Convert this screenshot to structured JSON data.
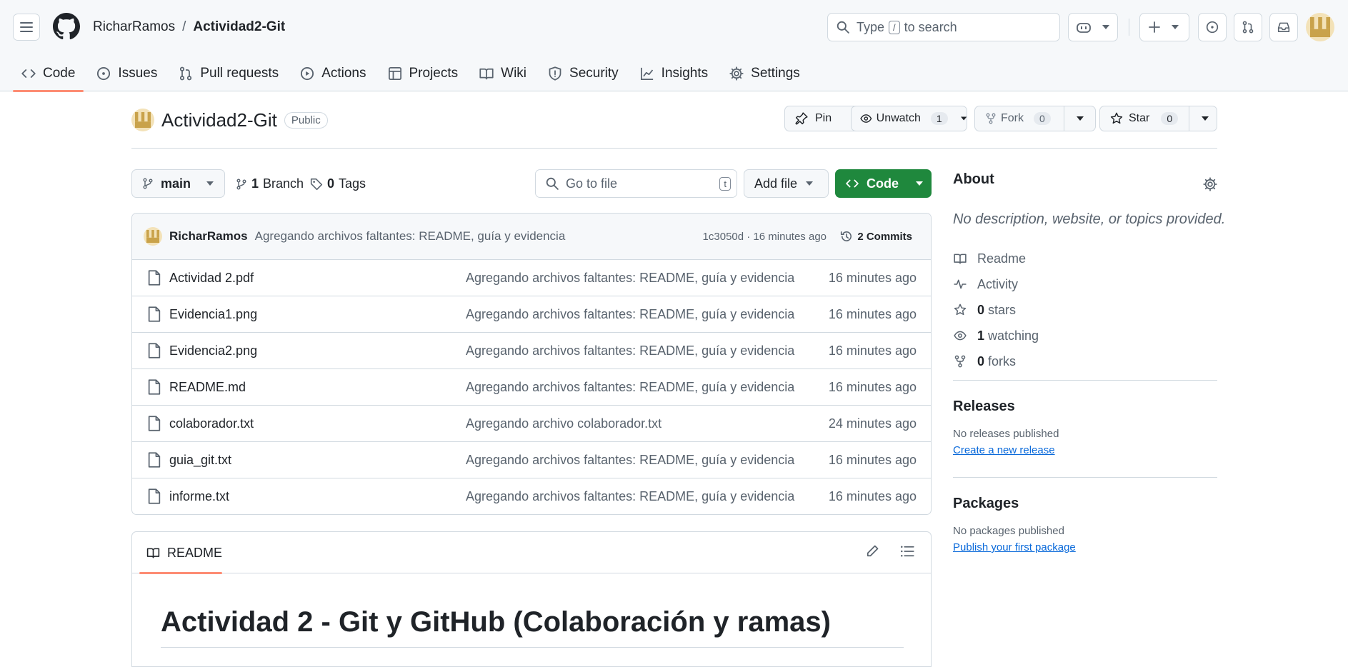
{
  "header": {
    "owner": "RicharRamos",
    "separator": "/",
    "repo": "Actividad2-Git",
    "search_prefix": "Type",
    "search_key": "/",
    "search_suffix": "to search"
  },
  "tabs": [
    {
      "label": "Code",
      "icon": "code-icon"
    },
    {
      "label": "Issues",
      "icon": "issue-icon"
    },
    {
      "label": "Pull requests",
      "icon": "pull-request-icon"
    },
    {
      "label": "Actions",
      "icon": "play-icon"
    },
    {
      "label": "Projects",
      "icon": "table-icon"
    },
    {
      "label": "Wiki",
      "icon": "book-icon"
    },
    {
      "label": "Security",
      "icon": "shield-icon"
    },
    {
      "label": "Insights",
      "icon": "graph-icon"
    },
    {
      "label": "Settings",
      "icon": "gear-icon"
    }
  ],
  "repo": {
    "name": "Actividad2-Git",
    "visibility": "Public",
    "pin_label": "Pin",
    "watch_label": "Unwatch",
    "watch_count": "1",
    "fork_label": "Fork",
    "fork_count": "0",
    "star_label": "Star",
    "star_count": "0"
  },
  "toolbar": {
    "branch": "main",
    "branches_count": "1",
    "branches_label": "Branch",
    "tags_count": "0",
    "tags_label": "Tags",
    "goto_placeholder": "Go to file",
    "goto_key": "t",
    "add_file_label": "Add file",
    "code_label": "Code"
  },
  "commit": {
    "author": "RicharRamos",
    "message": "Agregando archivos faltantes: README, guía y evidencia",
    "sha_time": "1c3050d · 16 minutes ago",
    "commits_label": "2 Commits"
  },
  "files": [
    {
      "name": "Actividad 2.pdf",
      "message": "Agregando archivos faltantes: README, guía y evidencia",
      "time": "16 minutes ago"
    },
    {
      "name": "Evidencia1.png",
      "message": "Agregando archivos faltantes: README, guía y evidencia",
      "time": "16 minutes ago"
    },
    {
      "name": "Evidencia2.png",
      "message": "Agregando archivos faltantes: README, guía y evidencia",
      "time": "16 minutes ago"
    },
    {
      "name": "README.md",
      "message": "Agregando archivos faltantes: README, guía y evidencia",
      "time": "16 minutes ago"
    },
    {
      "name": "colaborador.txt",
      "message": "Agregando archivo colaborador.txt",
      "time": "24 minutes ago"
    },
    {
      "name": "guia_git.txt",
      "message": "Agregando archivos faltantes: README, guía y evidencia",
      "time": "16 minutes ago"
    },
    {
      "name": "informe.txt",
      "message": "Agregando archivos faltantes: README, guía y evidencia",
      "time": "16 minutes ago"
    }
  ],
  "readme": {
    "tab_label": "README",
    "heading": "Actividad 2 - Git y GitHub (Colaboración y ramas)"
  },
  "about": {
    "title": "About",
    "description": "No description, website, or topics provided.",
    "readme": "Readme",
    "activity": "Activity",
    "stars_count": "0",
    "stars_label": "stars",
    "watching_count": "1",
    "watching_label": "watching",
    "forks_count": "0",
    "forks_label": "forks"
  },
  "releases": {
    "title": "Releases",
    "empty": "No releases published",
    "link": "Create a new release"
  },
  "packages": {
    "title": "Packages",
    "empty": "No packages published",
    "link": "Publish your first package"
  },
  "colors": {
    "accent_tab": "#fd8c73",
    "code_button": "#1f883d",
    "link": "#0969da"
  }
}
